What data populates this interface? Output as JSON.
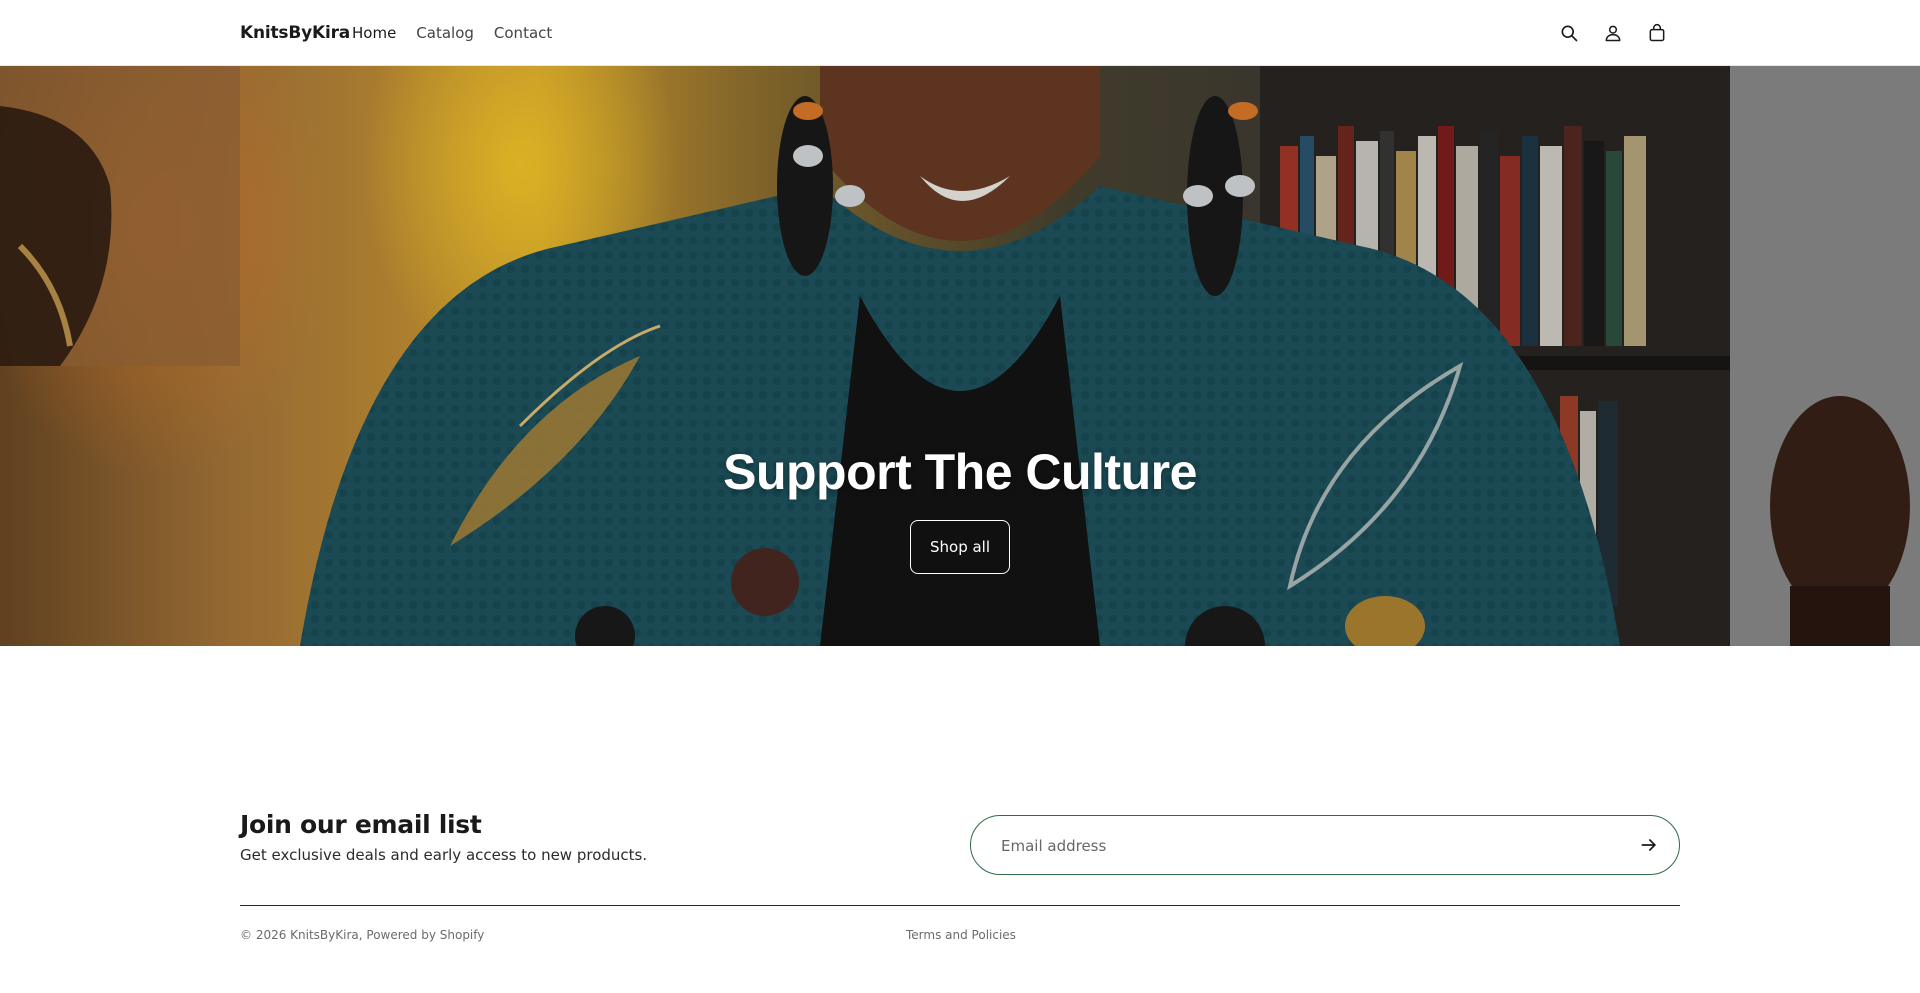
{
  "header": {
    "brand": "KnitsByKira",
    "nav": [
      {
        "label": "Home"
      },
      {
        "label": "Catalog"
      },
      {
        "label": "Contact"
      }
    ]
  },
  "hero": {
    "title": "Support The Culture",
    "button_label": "Shop all"
  },
  "newsletter": {
    "title": "Join our email list",
    "subtitle": "Get exclusive deals and early access to new products.",
    "email_placeholder": "Email address"
  },
  "footer": {
    "copyright": "© 2026 KnitsByKira, Powered by Shopify",
    "policies_link": "Terms and Policies"
  },
  "icons": [
    "search-icon",
    "account-icon",
    "cart-icon",
    "arrow-right-icon"
  ],
  "colors": {
    "accent_border": "#2f6a47",
    "text": "#1a1a1a",
    "muted": "#6b6b6b"
  }
}
